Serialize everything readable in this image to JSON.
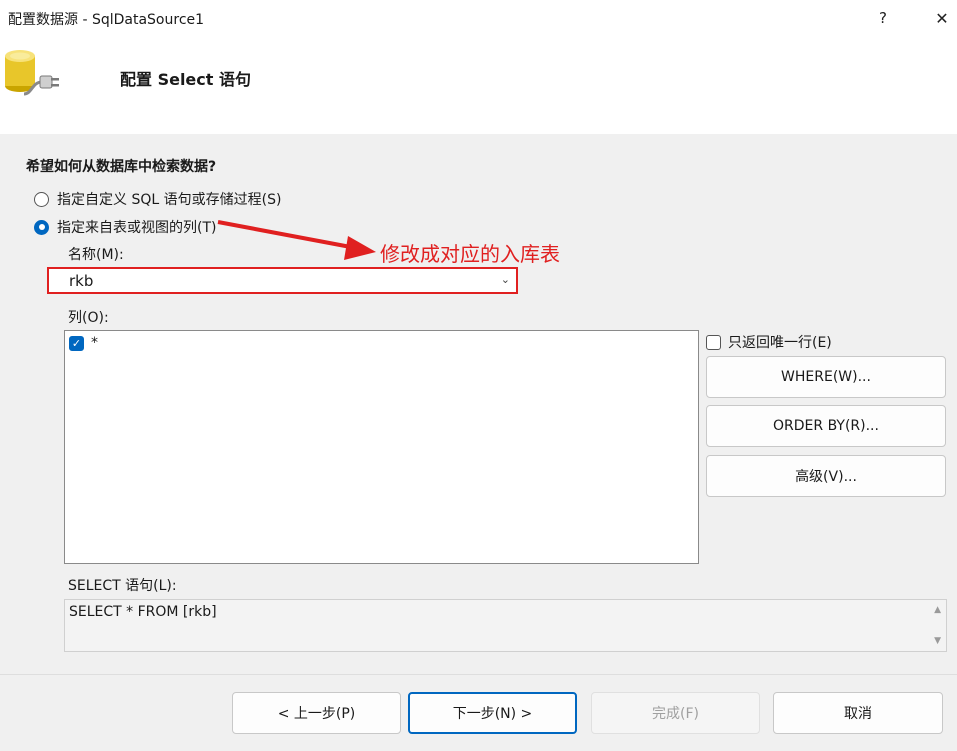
{
  "window": {
    "title": "配置数据源 - SqlDataSource1",
    "help_label": "?",
    "close_label": "✕"
  },
  "header": {
    "icon": "database-plug-icon",
    "step_title": "配置 Select 语句"
  },
  "main": {
    "question": "希望如何从数据库中检索数据?",
    "option_custom": "指定自定义 SQL 语句或存储过程(S)",
    "option_table": "指定来自表或视图的列(T)",
    "selected_option": "option_table",
    "name_label": "名称(M):",
    "name_value": "rkb",
    "columns_label": "列(O):",
    "columns": [
      {
        "label": "*",
        "checked": true
      }
    ],
    "unique_rows_label": "只返回唯一行(E)",
    "unique_rows_checked": false,
    "where_button": "WHERE(W)...",
    "orderby_button": "ORDER BY(R)...",
    "advanced_button": "高级(V)...",
    "select_label": "SELECT 语句(L):",
    "select_statement": "SELECT * FROM [rkb]"
  },
  "annotation": {
    "text": "修改成对应的入库表",
    "color": "#e02020"
  },
  "footer": {
    "prev_button": "< 上一步(P)",
    "next_button": "下一步(N) >",
    "finish_button": "完成(F)",
    "cancel_button": "取消"
  },
  "colors": {
    "accent": "#0067c0",
    "annotation": "#e02020"
  }
}
